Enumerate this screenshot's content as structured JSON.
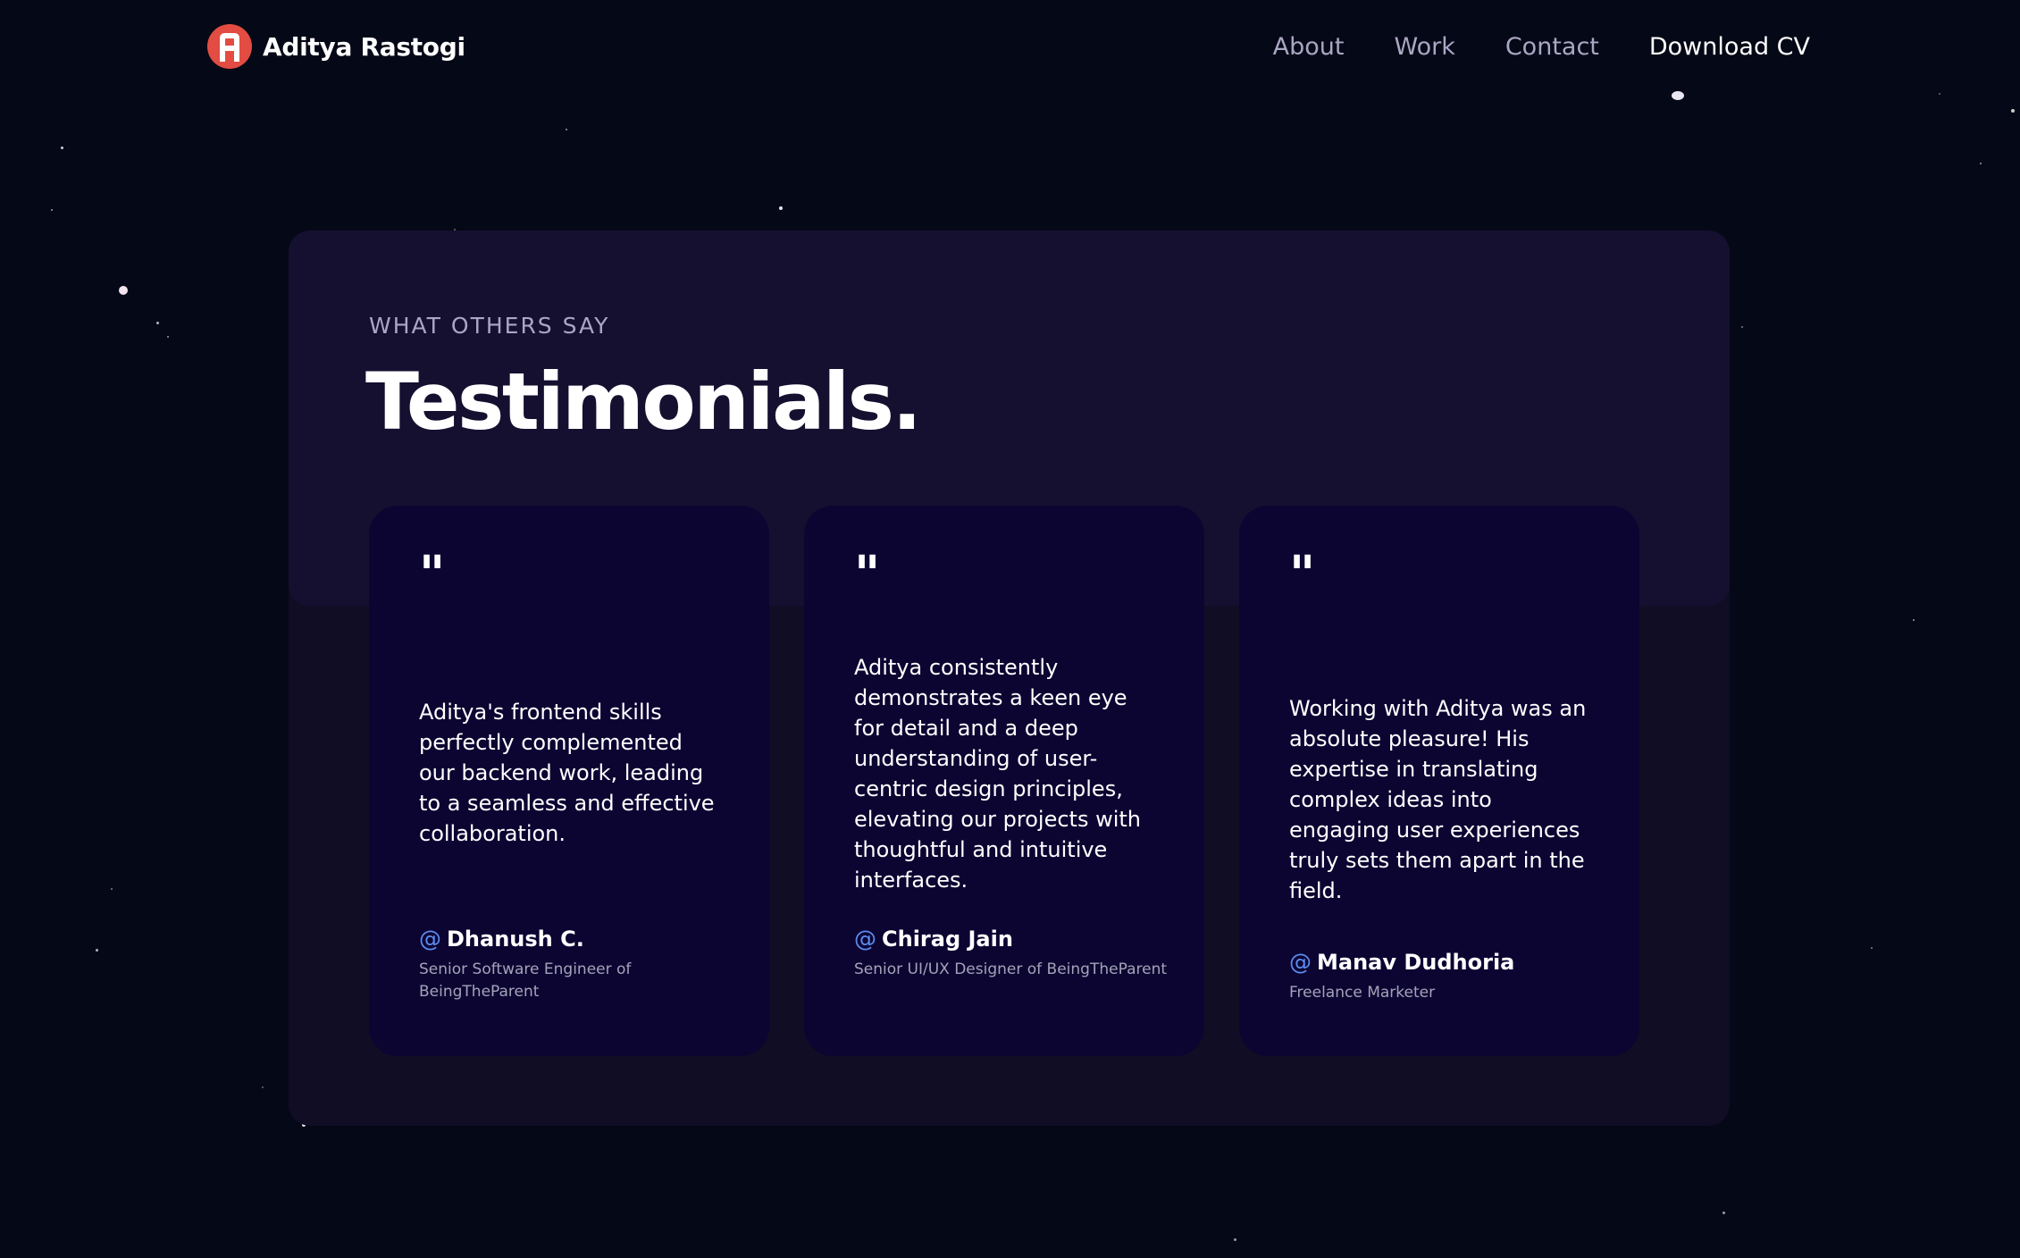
{
  "header": {
    "brand_name": "Aditya Rastogi",
    "logo_icon": "ar-monogram-icon",
    "nav": [
      {
        "label": "About"
      },
      {
        "label": "Work"
      },
      {
        "label": "Contact"
      },
      {
        "label": "Download CV"
      }
    ]
  },
  "testimonials": {
    "subtitle": "WHAT OTHERS SAY",
    "title": "Testimonials.",
    "quote_icon": "quote-icon",
    "items": [
      {
        "quote_mark": "\"",
        "text": "Aditya's frontend skills perfectly complemented our backend work, leading to a seamless and effective collaboration.",
        "at": "@",
        "name": "Dhanush C.",
        "role": "Senior Software Engineer of BeingTheParent"
      },
      {
        "quote_mark": "\"",
        "text": "Aditya consistently demonstrates a keen eye for detail and a deep understanding of user-centric design principles, elevating our projects with thoughtful and intuitive interfaces.",
        "at": "@",
        "name": "Chirag Jain",
        "role": "Senior UI/UX Designer of BeingTheParent"
      },
      {
        "quote_mark": "\"",
        "text": "Working with Aditya was an absolute pleasure! His expertise in translating complex ideas into engaging user experiences truly sets them apart in the field.",
        "at": "@",
        "name": "Manav Dudhoria",
        "role": "Freelance Marketer"
      }
    ]
  },
  "colors": {
    "background": "#050816",
    "section_bg": "#100d25",
    "section_head_bg": "#151030",
    "card_bg": "#0c0532",
    "secondary_text": "#aaa6c3",
    "accent_blue": "#5b8cf0",
    "logo_red": "#e24c42"
  }
}
